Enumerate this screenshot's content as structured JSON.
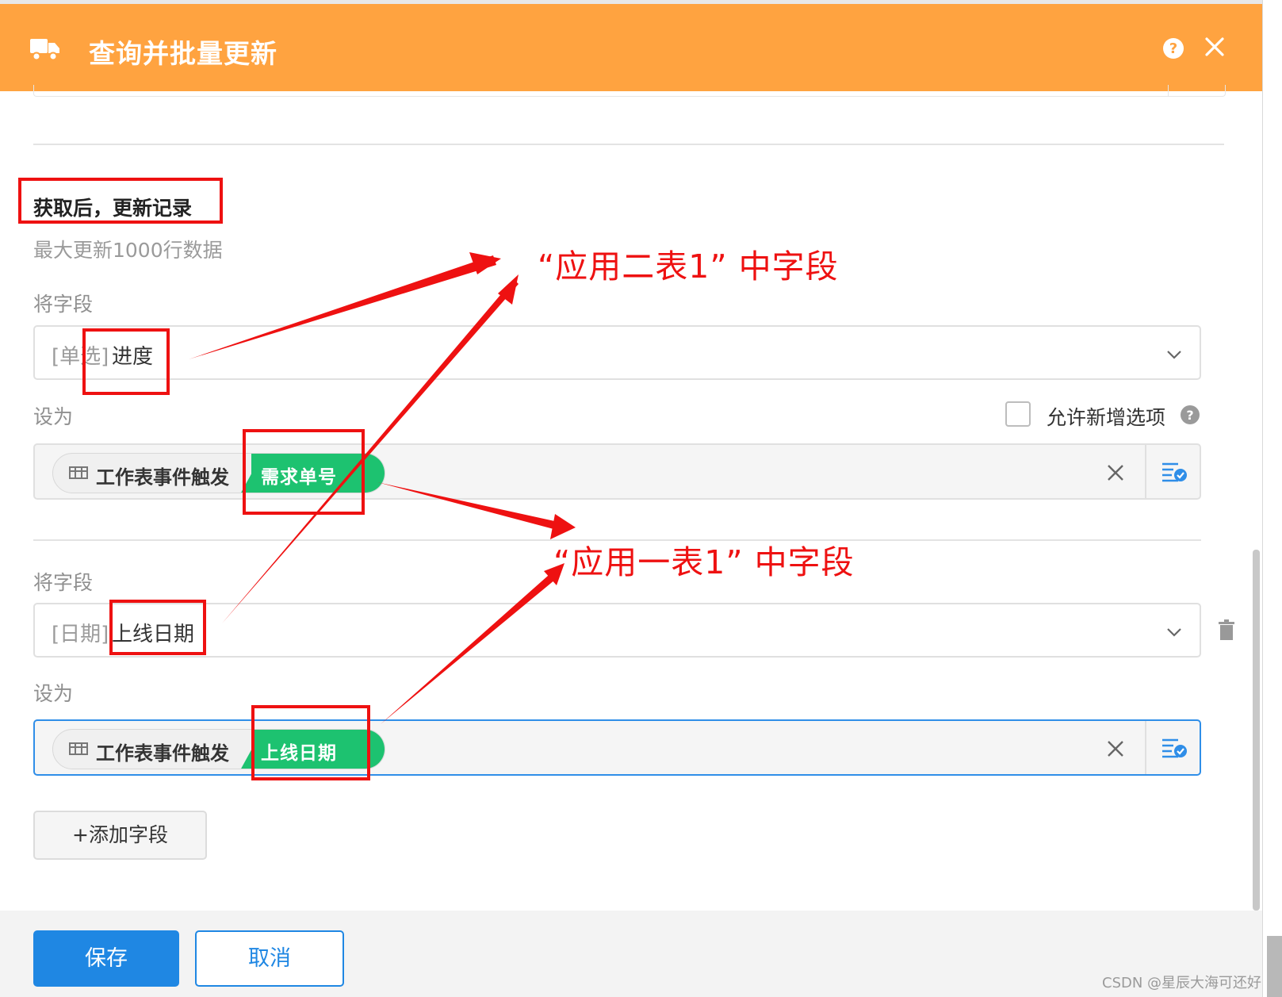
{
  "header": {
    "title": "查询并批量更新",
    "truck_icon": "truck-icon",
    "help_icon": "help-circle-icon",
    "close_icon": "close-icon",
    "background": "#ffa340"
  },
  "section": {
    "title": "获取后，更新记录",
    "hint": "最大更新1000行数据"
  },
  "rows": [
    {
      "field_label": "将字段",
      "field_prefix": "[单选]",
      "field_value": "进度",
      "set_label": "设为",
      "source": "工作表事件触发",
      "target_field": "需求单号"
    },
    {
      "field_label": "将字段",
      "field_prefix": "[日期]",
      "field_value": "上线日期",
      "set_label": "设为",
      "source": "工作表事件触发",
      "target_field": "上线日期"
    }
  ],
  "allow_new_option": {
    "label": "允许新增选项",
    "checked": false
  },
  "add_field_button": "+添加字段",
  "footer": {
    "save": "保存",
    "cancel": "取消"
  },
  "annotations": {
    "app2": "“应用二表1”  中字段",
    "app1": "“应用一表1”  中字段",
    "color": "#ee1111"
  },
  "watermark": "CSDN @星辰大海可还好",
  "colors": {
    "primary": "#1f87e3",
    "tag_green": "#1dc270",
    "header_orange": "#ffa340"
  }
}
